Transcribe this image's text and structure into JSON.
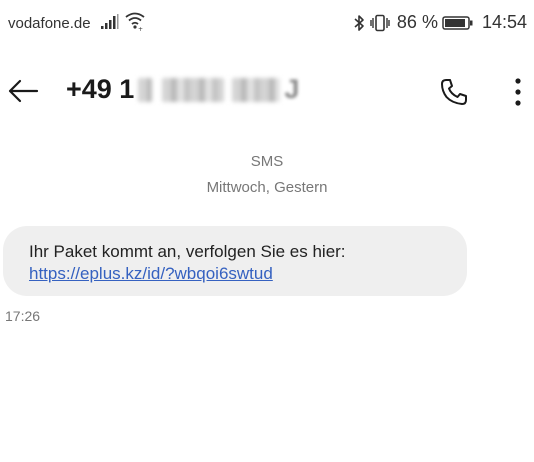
{
  "status_bar": {
    "carrier": "vodafone.de",
    "battery_percent": "86 %",
    "time": "14:54"
  },
  "app_bar": {
    "contact_visible": "+49 1",
    "contact_trailing": "J"
  },
  "conversation": {
    "channel": "SMS",
    "date": "Mittwoch, Gestern"
  },
  "message": {
    "text": "Ihr Paket kommt an, verfolgen Sie es hier:",
    "link": "https://eplus.kz/id/?wbqoi6swtud",
    "time": "17:26"
  }
}
